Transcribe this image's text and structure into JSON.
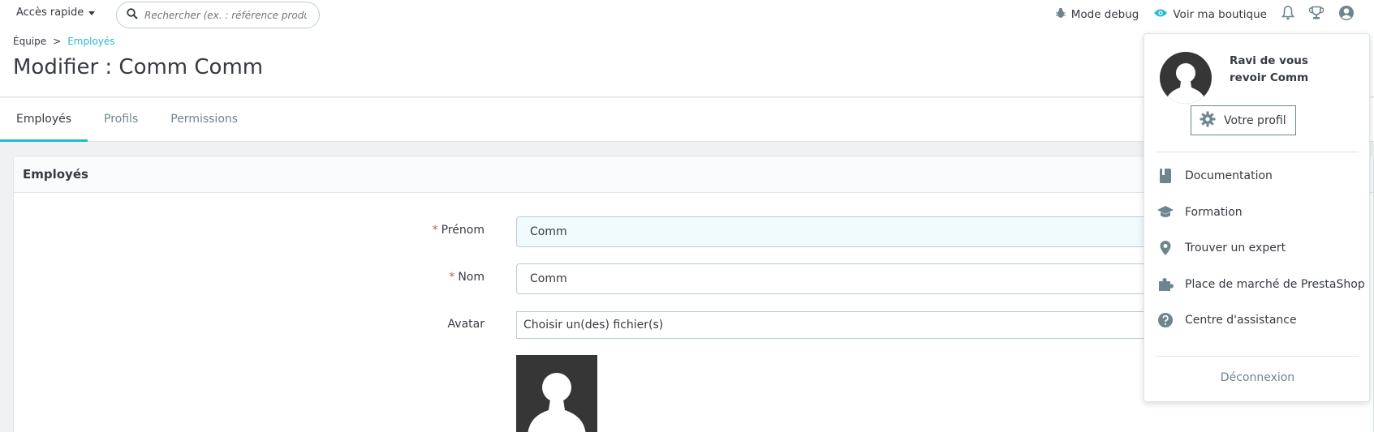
{
  "topbar": {
    "quick_access": "Accès rapide",
    "search_placeholder": "Rechercher (ex. : référence produit, no",
    "debug": "Mode debug",
    "view_shop": "Voir ma boutique"
  },
  "breadcrumb": {
    "parent": "Équipe",
    "separator": ">",
    "current": "Employés"
  },
  "page": {
    "title": "Modifier : Comm Comm"
  },
  "tabs": [
    {
      "label": "Employés"
    },
    {
      "label": "Profils"
    },
    {
      "label": "Permissions"
    }
  ],
  "panel": {
    "title": "Employés",
    "firstname_label": "Prénom",
    "firstname_value": "Comm",
    "lastname_label": "Nom",
    "lastname_value": "Comm",
    "avatar_label": "Avatar",
    "file_button": "Choisir un(des) fichier(s)",
    "required_mark": "*"
  },
  "dropdown": {
    "welcome": "Ravi de vous revoir Comm",
    "profile_button": "Votre profil",
    "items": [
      {
        "label": "Documentation",
        "icon": "book-icon"
      },
      {
        "label": "Formation",
        "icon": "school-icon"
      },
      {
        "label": "Trouver un expert",
        "icon": "location-pin-icon"
      },
      {
        "label": "Place de marché de PrestaShop",
        "icon": "puzzle-icon"
      },
      {
        "label": "Centre d'assistance",
        "icon": "help-icon"
      }
    ],
    "logout": "Déconnexion"
  },
  "colors": {
    "accent": "#25b9d7",
    "text": "#363a41",
    "muted": "#6c868e",
    "required": "#c05c67"
  }
}
